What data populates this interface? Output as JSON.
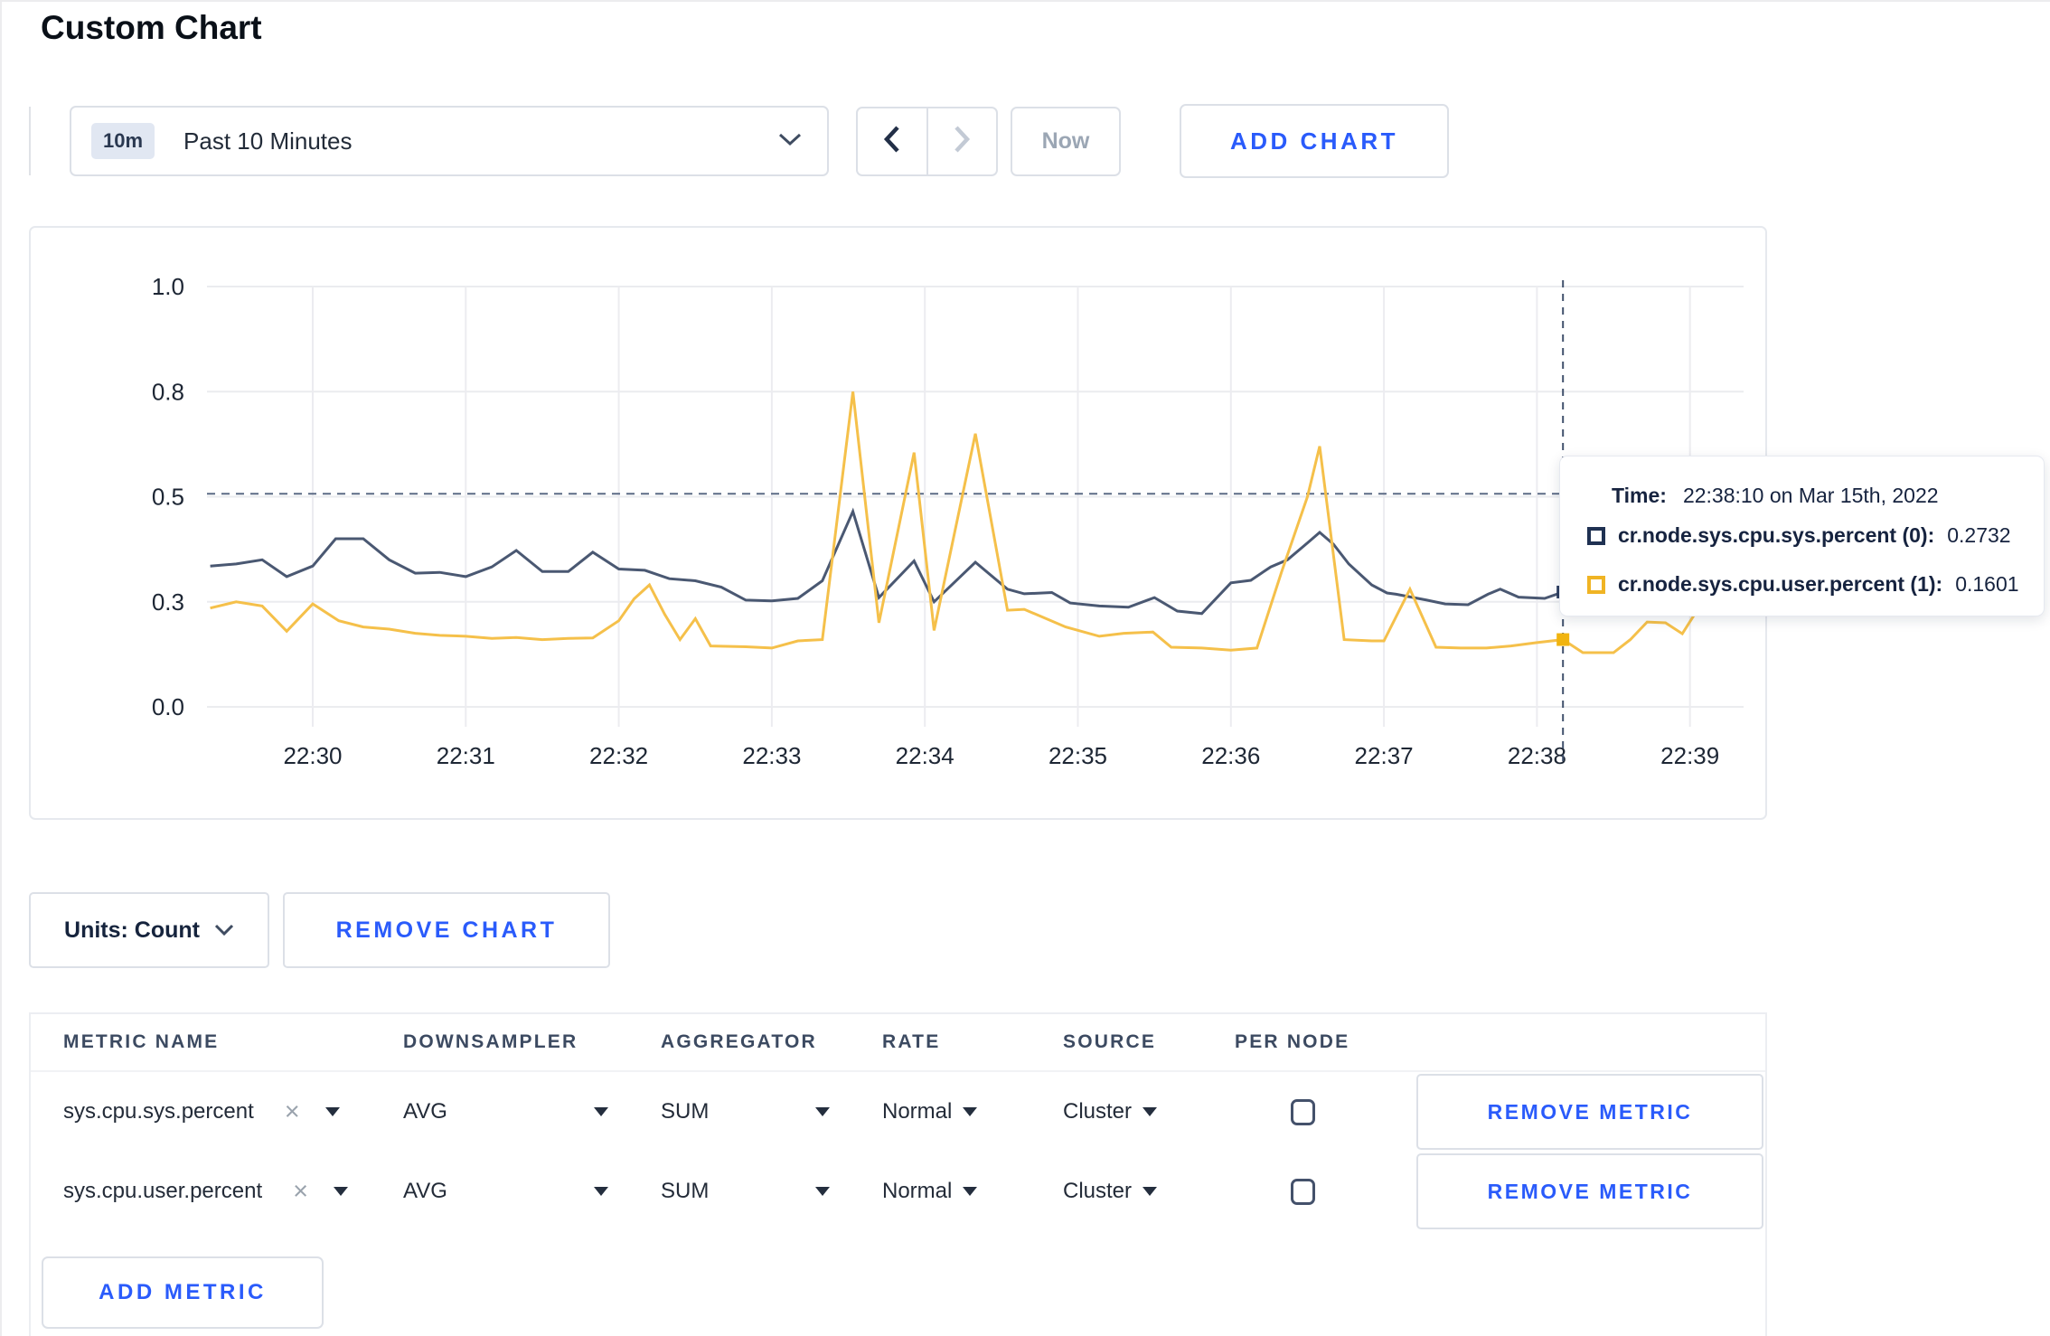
{
  "page": {
    "title": "Custom Chart"
  },
  "toolbar": {
    "time_window_badge": "10m",
    "time_window_label": "Past 10 Minutes",
    "now_label": "Now",
    "add_chart_label": "ADD CHART"
  },
  "chart": {
    "tooltip": {
      "time_label": "Time:",
      "time_value": "22:38:10 on Mar 15th, 2022",
      "rows": [
        {
          "name": "cr.node.sys.cpu.sys.percent (0):",
          "value": "0.2732",
          "color": "#1f3152"
        },
        {
          "name": "cr.node.sys.cpu.user.percent (1):",
          "value": "0.1601",
          "color": "#f0b424"
        }
      ]
    }
  },
  "chart_data": {
    "type": "line",
    "title": "",
    "xlabel": "",
    "ylabel": "",
    "x_tick_labels": [
      "22:30",
      "22:31",
      "22:32",
      "22:33",
      "22:34",
      "22:35",
      "22:36",
      "22:37",
      "22:38",
      "22:39"
    ],
    "x_unit": "minutes relative to 22:30",
    "y_ticks": [
      {
        "value": 0.0,
        "label": "0.0"
      },
      {
        "value": 0.25,
        "label": "0.3"
      },
      {
        "value": 0.5,
        "label": "0.5"
      },
      {
        "value": 0.75,
        "label": "0.8"
      },
      {
        "value": 1.0,
        "label": "1.0"
      }
    ],
    "ylim": [
      0,
      1
    ],
    "grid": true,
    "guide_line_y": 0.507,
    "crosshair": {
      "t_minutes": 8.17,
      "time": "22:38:10 on Mar 15th, 2022",
      "series_values": [
        0.2732,
        0.1601
      ]
    },
    "series": [
      {
        "name": "cr.node.sys.cpu.sys.percent (0)",
        "color": "#4a5872",
        "points": [
          [
            -0.67,
            0.335
          ],
          [
            -0.5,
            0.34
          ],
          [
            -0.33,
            0.35
          ],
          [
            -0.17,
            0.31
          ],
          [
            0,
            0.335
          ],
          [
            0.15,
            0.4
          ],
          [
            0.33,
            0.4
          ],
          [
            0.5,
            0.35
          ],
          [
            0.67,
            0.318
          ],
          [
            0.83,
            0.32
          ],
          [
            1,
            0.31
          ],
          [
            1.17,
            0.333
          ],
          [
            1.33,
            0.372
          ],
          [
            1.5,
            0.322
          ],
          [
            1.67,
            0.322
          ],
          [
            1.83,
            0.368
          ],
          [
            2,
            0.328
          ],
          [
            2.17,
            0.325
          ],
          [
            2.33,
            0.305
          ],
          [
            2.5,
            0.3
          ],
          [
            2.67,
            0.285
          ],
          [
            2.83,
            0.254
          ],
          [
            3,
            0.252
          ],
          [
            3.17,
            0.258
          ],
          [
            3.33,
            0.3
          ],
          [
            3.53,
            0.465
          ],
          [
            3.7,
            0.26
          ],
          [
            3.93,
            0.347
          ],
          [
            4.06,
            0.25
          ],
          [
            4.33,
            0.344
          ],
          [
            4.54,
            0.28
          ],
          [
            4.65,
            0.269
          ],
          [
            4.83,
            0.272
          ],
          [
            4.95,
            0.247
          ],
          [
            5.14,
            0.24
          ],
          [
            5.33,
            0.237
          ],
          [
            5.5,
            0.26
          ],
          [
            5.65,
            0.228
          ],
          [
            5.81,
            0.222
          ],
          [
            6,
            0.295
          ],
          [
            6.13,
            0.301
          ],
          [
            6.26,
            0.333
          ],
          [
            6.37,
            0.35
          ],
          [
            6.5,
            0.39
          ],
          [
            6.58,
            0.415
          ],
          [
            6.67,
            0.387
          ],
          [
            6.77,
            0.34
          ],
          [
            6.92,
            0.29
          ],
          [
            7.02,
            0.271
          ],
          [
            7.08,
            0.268
          ],
          [
            7.28,
            0.254
          ],
          [
            7.4,
            0.245
          ],
          [
            7.55,
            0.243
          ],
          [
            7.68,
            0.268
          ],
          [
            7.76,
            0.28
          ],
          [
            7.88,
            0.261
          ],
          [
            8.05,
            0.258
          ],
          [
            8.17,
            0.2732
          ],
          [
            8.4,
            0.27
          ],
          [
            8.7,
            0.285
          ],
          [
            9.1,
            0.3
          ]
        ]
      },
      {
        "name": "cr.node.sys.cpu.user.percent (1)",
        "color": "#f5c04a",
        "points": [
          [
            -0.67,
            0.235
          ],
          [
            -0.5,
            0.25
          ],
          [
            -0.33,
            0.24
          ],
          [
            -0.17,
            0.18
          ],
          [
            0,
            0.245
          ],
          [
            0.17,
            0.205
          ],
          [
            0.33,
            0.19
          ],
          [
            0.5,
            0.185
          ],
          [
            0.67,
            0.175
          ],
          [
            0.83,
            0.17
          ],
          [
            1,
            0.168
          ],
          [
            1.17,
            0.163
          ],
          [
            1.33,
            0.165
          ],
          [
            1.5,
            0.16
          ],
          [
            1.67,
            0.163
          ],
          [
            1.83,
            0.164
          ],
          [
            2,
            0.205
          ],
          [
            2.1,
            0.257
          ],
          [
            2.2,
            0.29
          ],
          [
            2.3,
            0.22
          ],
          [
            2.4,
            0.16
          ],
          [
            2.5,
            0.21
          ],
          [
            2.6,
            0.145
          ],
          [
            2.83,
            0.143
          ],
          [
            3,
            0.14
          ],
          [
            3.17,
            0.157
          ],
          [
            3.33,
            0.16
          ],
          [
            3.53,
            0.75
          ],
          [
            3.7,
            0.2
          ],
          [
            3.93,
            0.605
          ],
          [
            4.06,
            0.182
          ],
          [
            4.33,
            0.65
          ],
          [
            4.54,
            0.23
          ],
          [
            4.65,
            0.232
          ],
          [
            4.92,
            0.19
          ],
          [
            5.14,
            0.168
          ],
          [
            5.3,
            0.175
          ],
          [
            5.49,
            0.178
          ],
          [
            5.61,
            0.142
          ],
          [
            5.81,
            0.14
          ],
          [
            6,
            0.135
          ],
          [
            6.17,
            0.14
          ],
          [
            6.33,
            0.32
          ],
          [
            6.5,
            0.5
          ],
          [
            6.58,
            0.62
          ],
          [
            6.74,
            0.16
          ],
          [
            6.92,
            0.157
          ],
          [
            7,
            0.157
          ],
          [
            7.17,
            0.28
          ],
          [
            7.34,
            0.142
          ],
          [
            7.5,
            0.14
          ],
          [
            7.67,
            0.14
          ],
          [
            7.83,
            0.145
          ],
          [
            8,
            0.153
          ],
          [
            8.17,
            0.1601
          ],
          [
            8.3,
            0.129
          ],
          [
            8.5,
            0.129
          ],
          [
            8.61,
            0.16
          ],
          [
            8.72,
            0.202
          ],
          [
            8.84,
            0.2
          ],
          [
            8.95,
            0.174
          ],
          [
            9.1,
            0.26
          ]
        ]
      }
    ]
  },
  "chart_controls": {
    "units_label": "Units: Count",
    "remove_chart_label": "REMOVE CHART"
  },
  "metrics_table": {
    "columns": [
      "METRIC NAME",
      "DOWNSAMPLER",
      "AGGREGATOR",
      "RATE",
      "SOURCE",
      "PER NODE"
    ],
    "rows": [
      {
        "metric": "sys.cpu.sys.percent",
        "downsampler": "AVG",
        "aggregator": "SUM",
        "rate": "Normal",
        "source": "Cluster",
        "per_node_checked": false,
        "remove_label": "REMOVE METRIC"
      },
      {
        "metric": "sys.cpu.user.percent",
        "downsampler": "AVG",
        "aggregator": "SUM",
        "rate": "Normal",
        "source": "Cluster",
        "per_node_checked": false,
        "remove_label": "REMOVE METRIC"
      }
    ],
    "add_metric_label": "ADD METRIC"
  }
}
